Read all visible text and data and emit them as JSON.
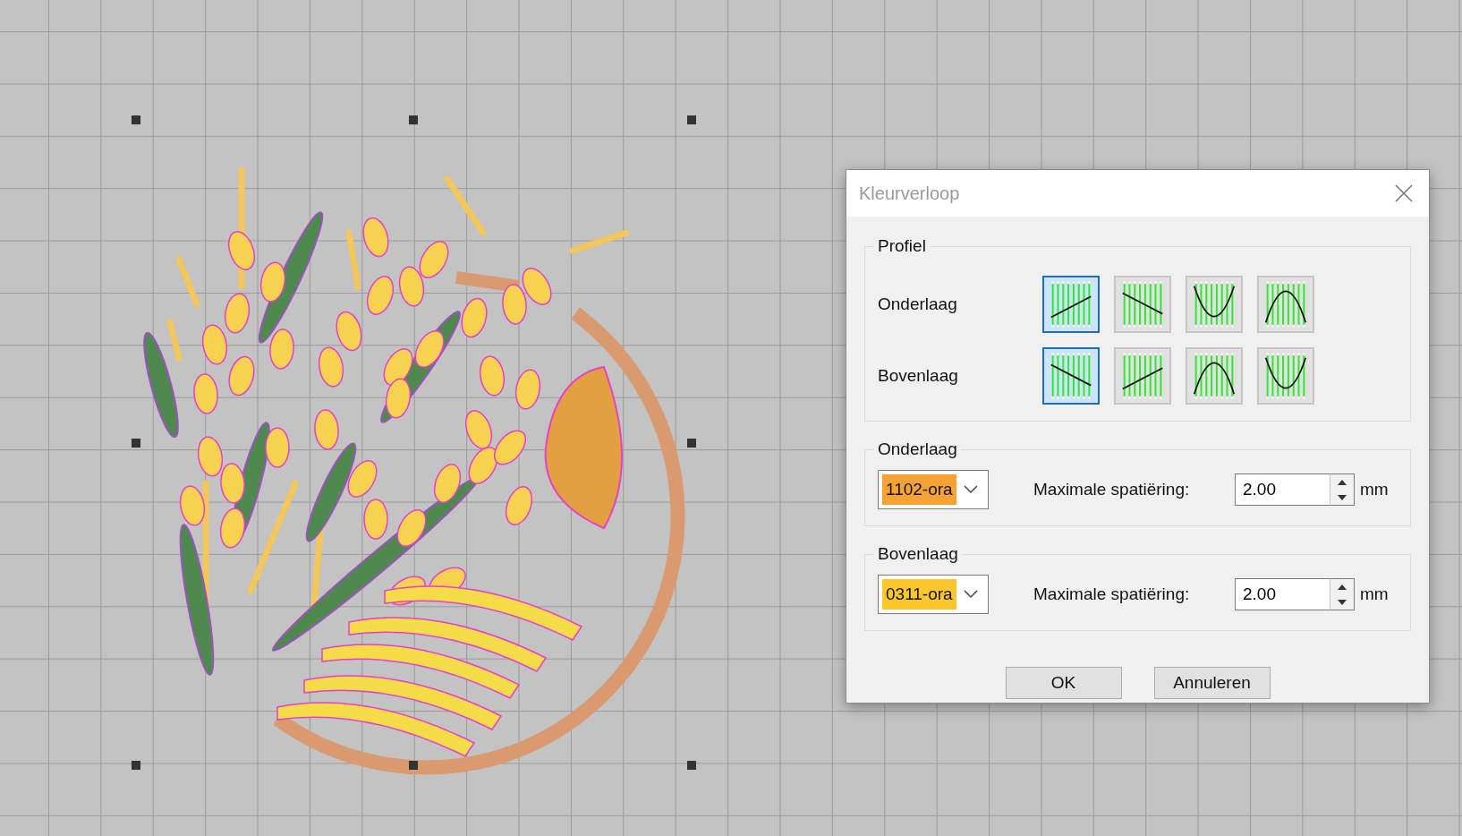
{
  "dialog": {
    "title": "Kleurverloop",
    "profile": {
      "title": "Profiel",
      "rows": [
        {
          "label": "Onderlaag",
          "options": [
            {
              "kind": "rise",
              "selected": true
            },
            {
              "kind": "fall",
              "selected": false
            },
            {
              "kind": "valley",
              "selected": false
            },
            {
              "kind": "hill",
              "selected": false
            }
          ]
        },
        {
          "label": "Bovenlaag",
          "options": [
            {
              "kind": "fall",
              "selected": true
            },
            {
              "kind": "rise",
              "selected": false
            },
            {
              "kind": "hill",
              "selected": false
            },
            {
              "kind": "valley",
              "selected": false
            }
          ]
        }
      ]
    },
    "layers": [
      {
        "title": "Onderlaag",
        "color_name": "1102-ora",
        "color": "#f6a235",
        "spacing_label": "Maximale spatiëring:",
        "spacing": "2.00",
        "unit": "mm"
      },
      {
        "title": "Bovenlaag",
        "color_name": "0311-ora",
        "color": "#fcc72c",
        "spacing_label": "Maximale spatiëring:",
        "spacing": "2.00",
        "unit": "mm"
      }
    ],
    "buttons": [
      "OK",
      "Annuleren"
    ]
  }
}
